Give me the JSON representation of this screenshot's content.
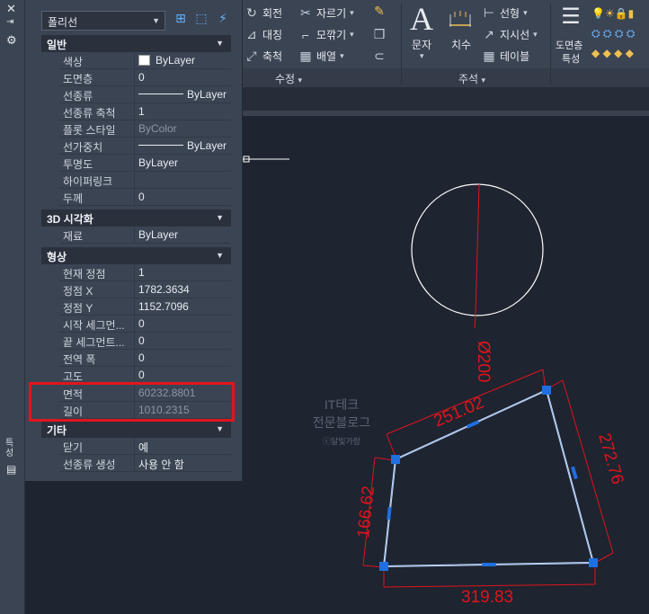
{
  "palette": {
    "selector": "폴리선",
    "sections": [
      {
        "title": "일반",
        "rows": [
          {
            "label": "색상",
            "value": "ByLayer"
          },
          {
            "label": "도면층",
            "value": "0"
          },
          {
            "label": "선종류",
            "value": "ByLayer"
          },
          {
            "label": "선종류 축척",
            "value": "1"
          },
          {
            "label": "플롯 스타일",
            "value": "ByColor"
          },
          {
            "label": "선가중치",
            "value": "ByLayer"
          },
          {
            "label": "투명도",
            "value": "ByLayer"
          },
          {
            "label": "하이퍼링크",
            "value": ""
          },
          {
            "label": "두께",
            "value": "0"
          }
        ]
      },
      {
        "title": "3D 시각화",
        "rows": [
          {
            "label": "재료",
            "value": "ByLayer"
          }
        ]
      },
      {
        "title": "형상",
        "rows": [
          {
            "label": "현재 정점",
            "value": "1"
          },
          {
            "label": "정점 X",
            "value": "1782.3634"
          },
          {
            "label": "정점 Y",
            "value": "1152.7096"
          },
          {
            "label": "시작 세그먼...",
            "value": "0"
          },
          {
            "label": "끝 세그먼트...",
            "value": "0"
          },
          {
            "label": "전역 폭",
            "value": "0"
          },
          {
            "label": "고도",
            "value": "0"
          },
          {
            "label": "면적",
            "value": "60232.8801"
          },
          {
            "label": "길이",
            "value": "1010.2315"
          }
        ]
      },
      {
        "title": "기타",
        "rows": [
          {
            "label": "닫기",
            "value": "예"
          },
          {
            "label": "선종류 생성",
            "value": "사용 안 함"
          }
        ]
      }
    ]
  },
  "ribbon": {
    "modify": {
      "rotate": "회전",
      "trim": "자르기",
      "mirror": "대칭",
      "fillet": "모깎기",
      "scale": "축척",
      "array": "배열",
      "title": "수정"
    },
    "annotation": {
      "text": "문자",
      "dimension": "치수",
      "linear": "선형",
      "leader": "지시선",
      "table": "테이블",
      "title": "주석"
    },
    "layers": {
      "properties_line1": "도면층",
      "properties_line2": "특성"
    }
  },
  "left_strip": {
    "vertical_label": "특성"
  },
  "drawing": {
    "circle_dim": "Ø200",
    "dim_top": "251.02",
    "dim_right": "272.76",
    "dim_left": "166.62",
    "dim_bottom": "319.83",
    "watermark_line1": "IT테크",
    "watermark_line2": "전문블로그",
    "watermark_line3": "ⓒ달빛가람"
  },
  "colors": {
    "dimension": "#e0141c",
    "grip": "#1f6fe0",
    "highlight": "#e0151e",
    "geometry": "#ffffff"
  }
}
